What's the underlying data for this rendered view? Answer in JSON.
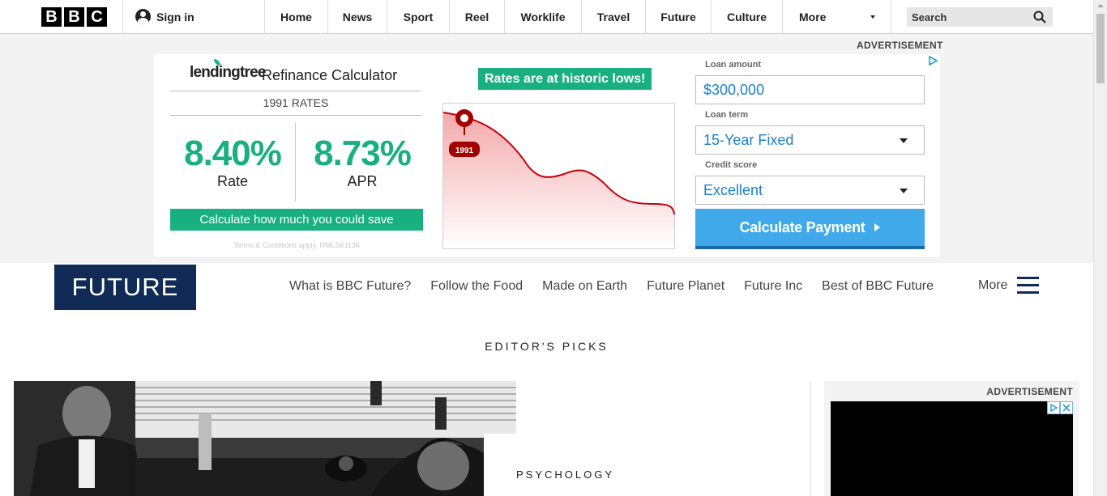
{
  "bbc_nav": {
    "logo_letters": [
      "B",
      "B",
      "C"
    ],
    "signin_label": "Sign in",
    "links": [
      "Home",
      "News",
      "Sport",
      "Reel",
      "Worklife",
      "Travel",
      "Future",
      "Culture"
    ],
    "more_label": "More",
    "search_placeholder": "Search"
  },
  "ad": {
    "label": "ADVERTISEMENT",
    "brand": "lendingtree",
    "title": "Refinance Calculator",
    "rates_year": "1991 RATES",
    "rate_value": "8.40%",
    "rate_label": "Rate",
    "apr_value": "8.73%",
    "apr_label": "APR",
    "calc_save_label": "Calculate how much you could save",
    "terms": "Terms & Conditions apply. NMLS#1136",
    "badge": "Rates are at historic lows!",
    "chart_marker_label": "1991",
    "loan_amount_label": "Loan amount",
    "loan_amount_value": "$300,000",
    "loan_term_label": "Loan term",
    "loan_term_value": "15-Year Fixed",
    "credit_score_label": "Credit score",
    "credit_score_value": "Excellent",
    "calc_payment_label": "Calculate Payment",
    "accent_green": "#19b07f",
    "accent_blue": "#3fa9ea"
  },
  "future": {
    "logo": "FUTURE",
    "nav": [
      "What is BBC Future?",
      "Follow the Food",
      "Made on Earth",
      "Future Planet",
      "Future Inc",
      "Best of BBC Future"
    ],
    "more_label": "More",
    "brand_color": "#0f2b56"
  },
  "editors_picks": {
    "heading": "EDITOR'S PICKS",
    "category": "PSYCHOLOGY"
  },
  "side_ad": {
    "label": "ADVERTISEMENT"
  }
}
